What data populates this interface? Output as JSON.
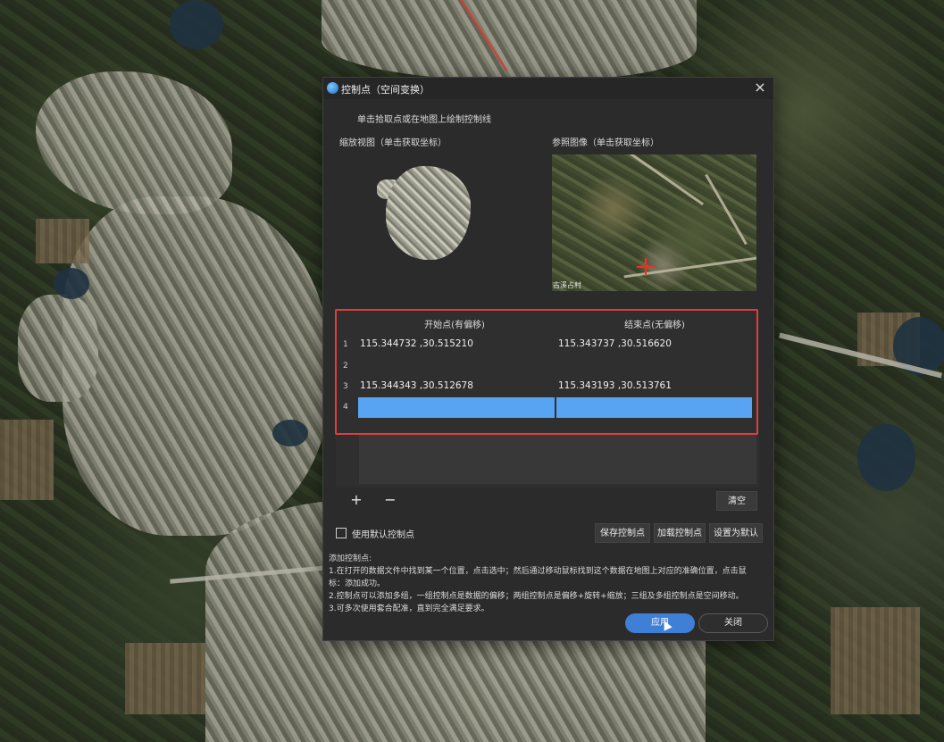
{
  "dialog": {
    "title": "控制点（空间变换）",
    "close_symbol": "×",
    "instruction": "单击拾取点或在地图上绘制控制线",
    "zoom_view_label": "缩放视图（单击获取坐标）",
    "reference_label": "参照图像（单击获取坐标）",
    "reference_caption": "古溪占村"
  },
  "table": {
    "headers": [
      "开始点(有偏移)",
      "结束点(无偏移)"
    ],
    "rows": [
      {
        "index": "1",
        "start": "115.344732 ,30.515210",
        "end": "115.343737 ,30.516620"
      },
      {
        "index": "2",
        "start": "",
        "end": ""
      },
      {
        "index": "3",
        "start": "115.344343 ,30.512678",
        "end": "115.343193 ,30.513761"
      },
      {
        "index": "4",
        "start": "",
        "end": ""
      }
    ],
    "selected_row": "4"
  },
  "toolbar": {
    "add_symbol": "+",
    "remove_symbol": "−",
    "clear_label": "清空",
    "save_label": "保存控制点",
    "load_label": "加载控制点",
    "default_label": "设置为默认",
    "use_default_label": "使用默认控制点"
  },
  "help": {
    "title": "添加控制点:",
    "line1": "1.在打开的数据文件中找到某一个位置，点击选中；然后通过移动鼠标找到这个数据在地图上对应的准确位置，点击鼠",
    "line1b": "标：添加成功。",
    "line2": "2.控制点可以添加多组，一组控制点是数据的偏移；两组控制点是偏移+旋转+缩放；三组及多组控制点是空间移动。",
    "line3": "3.可多次使用套合配准，直到完全满足要求。"
  },
  "footer": {
    "apply_label": "应用",
    "close_label": "关闭"
  },
  "colors": {
    "accent": "#3f7fd6",
    "selection": "#58a4f3",
    "highlight_border": "#e23b3b",
    "dialog_bg": "#2b2b2b"
  }
}
